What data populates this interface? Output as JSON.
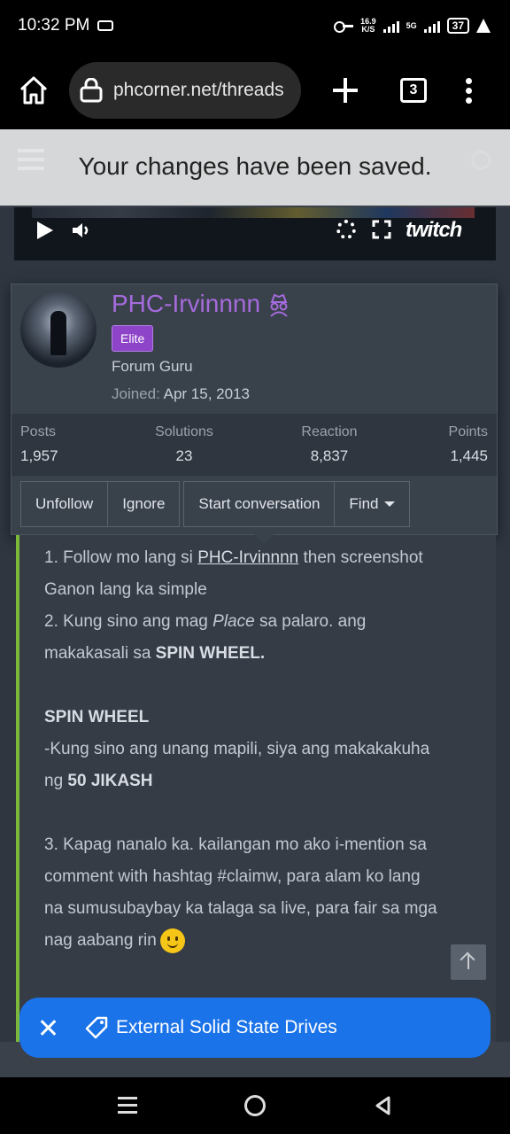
{
  "status_bar": {
    "time": "10:32 PM",
    "net_speed_value": "16.9",
    "net_speed_unit": "K/S",
    "network": "5G",
    "battery": "37"
  },
  "browser": {
    "url": "phcorner.net/threads",
    "tab_count": "3"
  },
  "toast": {
    "message": "Your changes have been saved."
  },
  "video": {
    "brand": "twitch"
  },
  "user": {
    "username": "PHC-Irvinnnn",
    "badge": "Elite",
    "title": "Forum Guru",
    "joined_label": "Joined:",
    "joined_date": "Apr 15, 2013",
    "stats": [
      {
        "label": "Posts",
        "value": "1,957"
      },
      {
        "label": "Solutions",
        "value": "23"
      },
      {
        "label": "Reaction",
        "value": "8,837"
      },
      {
        "label": "Points",
        "value": "1,445"
      }
    ],
    "actions": {
      "unfollow": "Unfollow",
      "ignore": "Ignore",
      "start_conversation": "Start conversation",
      "find": "Find"
    },
    "accent_color": "#a66bdd"
  },
  "post": {
    "line1_a": "1. Follow mo lang si ",
    "line1_link": "PHC-Irvinnnn",
    "line1_b": " then screenshot",
    "line2": "Ganon lang ka simple",
    "line3_a": "2. Kung sino ang mag ",
    "line3_em": "Place",
    "line3_b": " sa palaro. ang",
    "line4_a": "makakasali sa ",
    "line4_strong": "SPIN WHEEL.",
    "spin_heading": "SPIN WHEEL",
    "line5": "-Kung sino ang unang mapili, siya ang makakakuha",
    "line6_a": "ng ",
    "line6_strong": "50 JIKASH",
    "line7": "3. Kapag nanalo ka. kailangan mo ako i-mention sa",
    "line8": "comment with hashtag #claimw, para alam ko lang",
    "line9": "na sumusubaybay ka talaga sa live, para fair sa mga",
    "line10": "nag aabang rin",
    "border_color": "#7cb83a"
  },
  "snackbar": {
    "label": "External Solid State Drives",
    "color": "#1a73e8"
  }
}
